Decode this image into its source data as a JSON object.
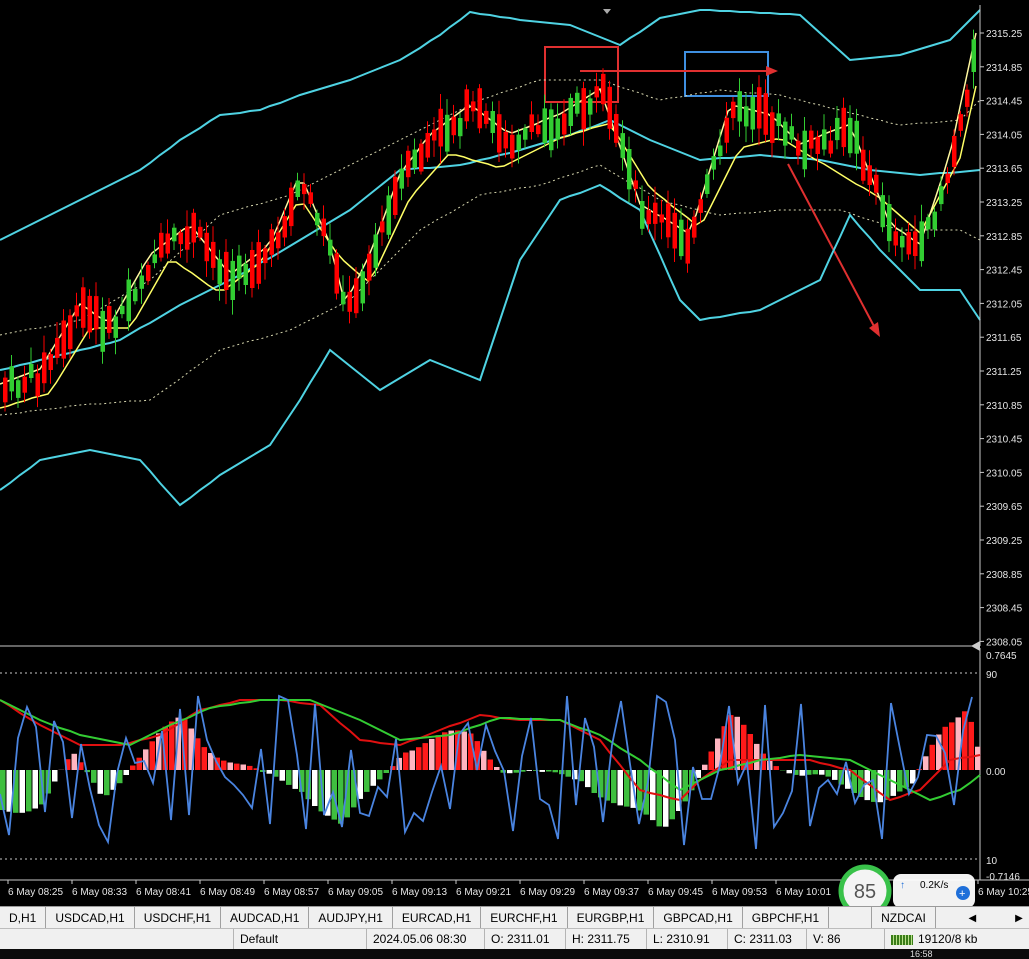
{
  "chart": {
    "price_axis": [
      "2315.25",
      "2314.85",
      "2314.45",
      "2314.05",
      "2313.65",
      "2313.25",
      "2312.85",
      "2312.45",
      "2312.05",
      "2311.65",
      "2311.25",
      "2310.85",
      "2310.45",
      "2310.05",
      "2309.65",
      "2309.25",
      "2308.85",
      "2308.45",
      "2308.05"
    ],
    "indicator_axis": [
      "0.7645",
      "90",
      "0.00",
      "10",
      "-0.7146"
    ],
    "time_axis": [
      "6 May 08:25",
      "6 May 08:33",
      "6 May 08:41",
      "6 May 08:49",
      "6 May 08:57",
      "6 May 09:05",
      "6 May 09:13",
      "6 May 09:21",
      "6 May 09:29",
      "6 May 09:37",
      "6 May 09:45",
      "6 May 09:53",
      "6 May 10:01",
      "6 May 10:25"
    ]
  },
  "colors": {
    "bull": "#32cd32",
    "bear": "#ff0000",
    "bollinger": "#4fd3e3",
    "ma": "#ffff66",
    "annotation_red": "#e03030",
    "annotation_blue": "#3f8fe0"
  },
  "tabs": [
    "D,H1",
    "USDCAD,H1",
    "USDCHF,H1",
    "AUDCAD,H1",
    "AUDJPY,H1",
    "EURCAD,H1",
    "EURCHF,H1",
    "EURGBP,H1",
    "GBPCAD,H1",
    "GBPCHF,H1",
    "",
    "NZDCAI"
  ],
  "status": {
    "profile": "Default",
    "datetime": "2024.05.06 08:30",
    "open": "O: 2311.01",
    "high": "H: 2311.75",
    "low": "L: 2310.91",
    "close": "C: 2311.03",
    "volume": "V: 86",
    "traffic": "19120/8 kb"
  },
  "net_widget": {
    "speed": "0.2K/s",
    "value": "85"
  },
  "clock": "16:58"
}
